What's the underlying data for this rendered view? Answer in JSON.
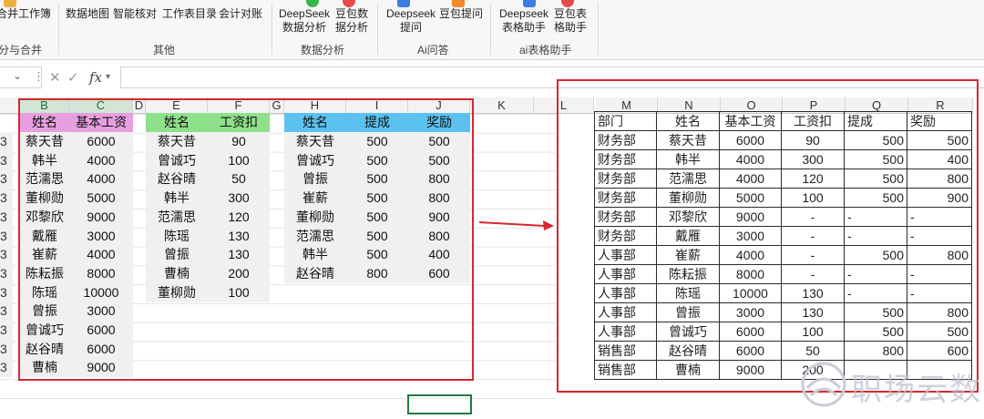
{
  "ribbon": {
    "buttons": [
      {
        "label": "合并工作簿",
        "icon": "merge-workbook-icon"
      },
      {
        "label": "数据地图",
        "icon": "data-map-icon"
      },
      {
        "label": "智能核对",
        "icon": "smart-check-icon"
      },
      {
        "label": "工作表目录",
        "icon": "sheet-toc-icon"
      },
      {
        "label": "会计对账",
        "icon": "accounting-icon"
      },
      {
        "label": "DeepSeek\n数据分析",
        "icon": "deepseek-icon"
      },
      {
        "label": "豆包数\n据分析",
        "icon": "doubao-icon"
      },
      {
        "label": "Deepseek\n提问",
        "icon": "deepseek-ask-icon"
      },
      {
        "label": "豆包提问",
        "icon": "doubao-ask-icon"
      },
      {
        "label": "Deepseek\n表格助手",
        "icon": "deepseek-table-icon"
      },
      {
        "label": "豆包表\n格助手",
        "icon": "doubao-table-icon"
      }
    ],
    "groups": [
      "分与合并",
      "其他",
      "数据分析",
      "Ai问答",
      "ai表格助手"
    ]
  },
  "formula_bar": {
    "namebox": "",
    "cancel": "✕",
    "confirm": "✓",
    "fx": "fx",
    "value": ""
  },
  "columns": {
    "left": [
      "B",
      "C",
      "D",
      "E",
      "F",
      "G",
      "H",
      "I",
      "J",
      "K",
      "L"
    ],
    "right": [
      "M",
      "N",
      "O",
      "P",
      "Q",
      "R"
    ]
  },
  "table1": {
    "headers": [
      "姓名",
      "基本工资"
    ],
    "rows": [
      [
        "蔡天昔",
        "6000"
      ],
      [
        "韩半",
        "4000"
      ],
      [
        "范濡思",
        "4000"
      ],
      [
        "董柳勋",
        "5000"
      ],
      [
        "邓黎欣",
        "9000"
      ],
      [
        "戴雁",
        "3000"
      ],
      [
        "崔薪",
        "4000"
      ],
      [
        "陈耘振",
        "8000"
      ],
      [
        "陈瑶",
        "10000"
      ],
      [
        "曾振",
        "3000"
      ],
      [
        "曾诚巧",
        "6000"
      ],
      [
        "赵谷晴",
        "6000"
      ],
      [
        "曹楠",
        "9000"
      ]
    ],
    "row_prefix": "3"
  },
  "table2": {
    "headers": [
      "姓名",
      "工资扣"
    ],
    "rows": [
      [
        "蔡天昔",
        "90"
      ],
      [
        "曾诚巧",
        "100"
      ],
      [
        "赵谷晴",
        "50"
      ],
      [
        "韩半",
        "300"
      ],
      [
        "范濡思",
        "120"
      ],
      [
        "陈瑶",
        "130"
      ],
      [
        "曾振",
        "130"
      ],
      [
        "曹楠",
        "200"
      ],
      [
        "董柳勋",
        "100"
      ]
    ]
  },
  "table3": {
    "headers": [
      "姓名",
      "提成",
      "奖励"
    ],
    "rows": [
      [
        "蔡天昔",
        "500",
        "500"
      ],
      [
        "曾诚巧",
        "500",
        "500"
      ],
      [
        "曾振",
        "500",
        "800"
      ],
      [
        "崔薪",
        "500",
        "800"
      ],
      [
        "董柳勋",
        "500",
        "900"
      ],
      [
        "范濡思",
        "500",
        "800"
      ],
      [
        "韩半",
        "500",
        "400"
      ],
      [
        "赵谷晴",
        "800",
        "600"
      ]
    ]
  },
  "result_table": {
    "headers": [
      "部门",
      "姓名",
      "基本工资",
      "工资扣",
      "提成",
      "奖励"
    ],
    "rows": [
      [
        "财务部",
        "蔡天昔",
        "6000",
        "90",
        "500",
        "500"
      ],
      [
        "财务部",
        "韩半",
        "4000",
        "300",
        "500",
        "400"
      ],
      [
        "财务部",
        "范濡思",
        "4000",
        "120",
        "500",
        "800"
      ],
      [
        "财务部",
        "董柳勋",
        "5000",
        "100",
        "500",
        "900"
      ],
      [
        "财务部",
        "邓黎欣",
        "9000",
        "-",
        "-",
        "-"
      ],
      [
        "财务部",
        "戴雁",
        "3000",
        "-",
        "-",
        "-"
      ],
      [
        "人事部",
        "崔薪",
        "4000",
        "-",
        "500",
        "800"
      ],
      [
        "人事部",
        "陈耘振",
        "8000",
        "-",
        "-",
        "-"
      ],
      [
        "人事部",
        "陈瑶",
        "10000",
        "130",
        "-",
        "-"
      ],
      [
        "人事部",
        "曾振",
        "3000",
        "130",
        "500",
        "800"
      ],
      [
        "人事部",
        "曾诚巧",
        "6000",
        "100",
        "500",
        "500"
      ],
      [
        "销售部",
        "赵谷晴",
        "6000",
        "50",
        "800",
        "600"
      ],
      [
        "销售部",
        "曹楠",
        "9000",
        "200",
        "",
        ""
      ]
    ]
  },
  "watermark": "职场云数",
  "colors": {
    "pink": "#e89fe0",
    "green": "#8fe08a",
    "blue": "#5bc2ef",
    "red_box": "#d8262e",
    "arrow": "#d8262e"
  }
}
